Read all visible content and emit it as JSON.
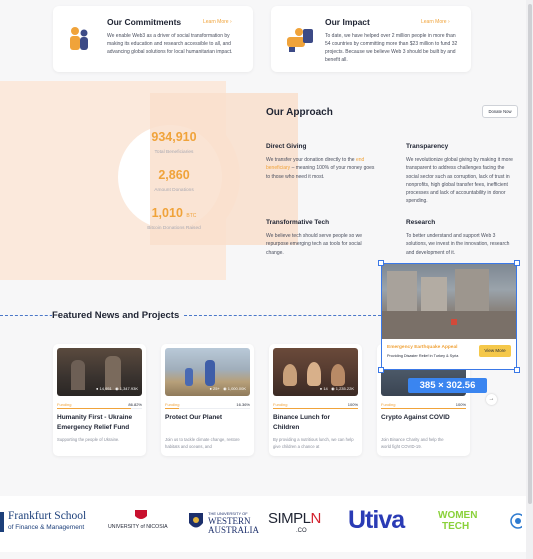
{
  "commitments": {
    "title": "Our Commitments",
    "learn_more": "Learn More",
    "text": "We enable Web3 as a driver of social transformation by making its education and research accessible to all, and advancing global solutions for local humanitarian impact."
  },
  "impact": {
    "title": "Our Impact",
    "learn_more": "Learn More",
    "text": "To date, we have helped over 2 million people in more than 54 countries by committing more than $23 million to fund 32 projects. Because we believe Web 3 should be built by and benefit all."
  },
  "approach": {
    "title": "Our Approach",
    "donate": "Donate Now",
    "stats": [
      {
        "value": "934,910",
        "unit": "",
        "label": "Total Beneficiaries"
      },
      {
        "value": "2,860",
        "unit": "",
        "label": "Amount Donations"
      },
      {
        "value": "1,010",
        "unit": "BTC",
        "label": "Bitcoin Donations Raised"
      }
    ],
    "direct": {
      "title": "Direct Giving",
      "pre": "We transfer your donation directly to the",
      "hl": "end beneficiary",
      "post": "– meaning 100% of your money goes to those who need it most."
    },
    "transparency": {
      "title": "Transparency",
      "text": "We revolutionize global giving by making it more transparent to address challenges facing the social sector such as corruption, lack of trust in nonprofits, high global transfer fees, inefficient processes and lack of accountability in donor spending."
    },
    "tech": {
      "title": "Transformative Tech",
      "text": "We believe tech should serve people so we repurpose emerging tech as tools for social change."
    },
    "research": {
      "title": "Research",
      "text": "To better understand and support Web 3 solutions, we invest in the innovation, research and development of it."
    }
  },
  "featured": {
    "title": "Featured News and Projects",
    "cards": [
      {
        "meta_a": "14,951",
        "meta_b": "1,347.93K",
        "status": "Funding",
        "pct": "86.82%",
        "fill": 0.868,
        "title": "Humanity First - Ukraine Emergency Relief Fund",
        "desc": "Supporting the people of Ukraine."
      },
      {
        "meta_a": "25+",
        "meta_b": "1,000.00K",
        "status": "Funding",
        "pct": "16.36%",
        "fill": 0.164,
        "title": "Protect Our Planet",
        "desc": "Join us to tackle climate change, restore habitats and oceans, and"
      },
      {
        "meta_a": "14",
        "meta_b": "1,235.22K",
        "status": "Funding",
        "pct": "100%",
        "fill": 1.0,
        "title": "Binance Lunch for Children",
        "desc": "By providing a nutritious lunch, we can help give children a chance at"
      },
      {
        "meta_a": "",
        "meta_b": "",
        "status": "Funding",
        "pct": "100%",
        "fill": 1.0,
        "title": "Crypto Against COVID",
        "desc": "Join Binance Charity and help the world fight COVID-19."
      }
    ]
  },
  "overlay": {
    "title": "Emergency Earthquake Appeal",
    "sub": "Providing Disaster Relief in Turkey & Syria",
    "button": "View More",
    "dimensions": "385 × 302.56"
  },
  "logos": {
    "frankfurt": [
      "Frankfurt School",
      "of Finance & Management"
    ],
    "nicosia": "UNIVERSITY of NICOSIA",
    "uwa": [
      "THE UNIVERSITY OF",
      "WESTERN",
      "AUSTRALIA"
    ],
    "simplon": [
      "SIMPL",
      "N",
      ".CO"
    ],
    "utiva": "Utiva",
    "womentech": [
      "WOMEN",
      "TECH"
    ]
  },
  "colors": {
    "accent": "#f0a33a",
    "selection": "#3a78e7",
    "peach": "#fbe9dc"
  }
}
